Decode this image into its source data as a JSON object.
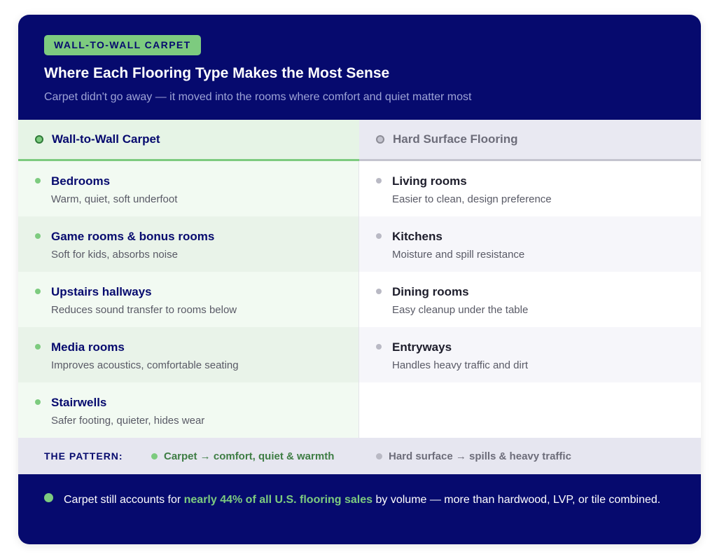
{
  "header": {
    "badge": "WALL-TO-WALL CARPET",
    "title": "Where Each Flooring Type Makes the Most Sense",
    "subtitle": "Carpet didn't go away — it moved into the rooms where comfort and quiet matter most"
  },
  "columns": {
    "carpet": {
      "heading": "Wall-to-Wall Carpet",
      "rows": [
        {
          "name": "Bedrooms",
          "desc": "Warm, quiet, soft underfoot"
        },
        {
          "name": "Game rooms & bonus rooms",
          "desc": "Soft for kids, absorbs noise"
        },
        {
          "name": "Upstairs hallways",
          "desc": "Reduces sound transfer to rooms below"
        },
        {
          "name": "Media rooms",
          "desc": "Improves acoustics, comfortable seating"
        },
        {
          "name": "Stairwells",
          "desc": "Safer footing, quieter, hides wear"
        }
      ]
    },
    "hard": {
      "heading": "Hard Surface Flooring",
      "rows": [
        {
          "name": "Living rooms",
          "desc": "Easier to clean, design preference"
        },
        {
          "name": "Kitchens",
          "desc": "Moisture and spill resistance"
        },
        {
          "name": "Dining rooms",
          "desc": "Easy cleanup under the table"
        },
        {
          "name": "Entryways",
          "desc": "Handles heavy traffic and dirt"
        }
      ]
    }
  },
  "pattern": {
    "label": "THE PATTERN:",
    "carpet": "Carpet → comfort, quiet & warmth",
    "hard": "Hard surface → spills & heavy traffic"
  },
  "footer": {
    "pre": "Carpet still accounts for ",
    "highlight": "nearly 44% of all U.S. flooring sales",
    "post": " by volume — more than hardwood, LVP, or tile combined."
  },
  "colors": {
    "navy": "#060a6e",
    "green": "#7dcb7f",
    "gray": "#b9b9c4"
  }
}
